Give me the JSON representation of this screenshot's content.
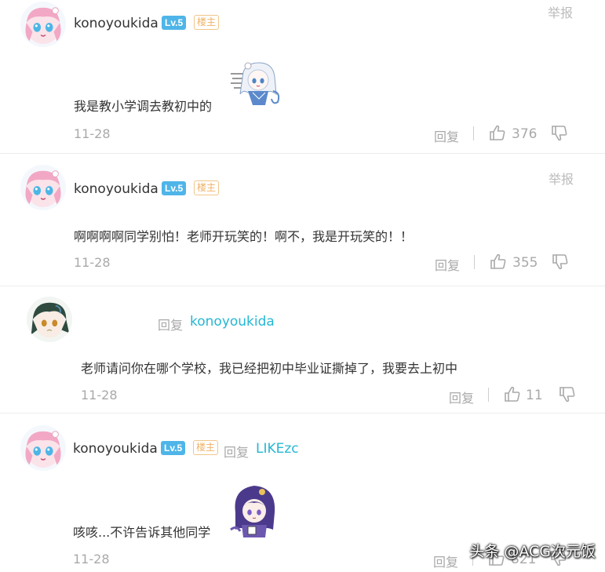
{
  "comments": [
    {
      "username": "konoyoukida",
      "level": "Lv.5",
      "op_badge": "楼主",
      "report": "举报",
      "text": "我是教小学调去教初中的",
      "date": "11-28",
      "reply_label": "回复",
      "likes": "376"
    },
    {
      "username": "konoyoukida",
      "level": "Lv.5",
      "op_badge": "楼主",
      "report": "举报",
      "text": "啊啊啊啊同学别怕！老师开玩笑的！啊不，我是开玩笑的！！",
      "date": "11-28",
      "reply_label": "回复",
      "likes": "355"
    },
    {
      "reply_word": "回复",
      "reply_to": "konoyoukida",
      "text": "老师请问你在哪个学校，我已经把初中毕业证撕掉了，我要去上初中",
      "date": "11-28",
      "reply_label": "回复",
      "likes": "11"
    },
    {
      "username": "konoyoukida",
      "level": "Lv.5",
      "op_badge": "楼主",
      "reply_word": "回复",
      "reply_to": "LIKEzc",
      "text": "咳咳...不许告诉其他同学",
      "date": "11-28",
      "reply_label": "回复",
      "likes": "821"
    }
  ],
  "watermark": "头条 @ACG次元饭",
  "icons": {
    "like": "thumbs-up-icon",
    "dislike": "thumbs-down-icon"
  },
  "colors": {
    "level_badge": "#4fb5e8",
    "op_badge": "#f0b266",
    "reply_target": "#25b7d3",
    "meta_text": "#a9a9a9"
  }
}
